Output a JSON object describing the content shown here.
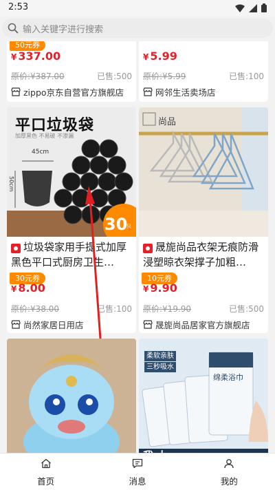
{
  "status_bar": {
    "time": "2:53"
  },
  "search": {
    "placeholder": "输入关键字进行搜索"
  },
  "products": [
    {
      "coupon": "50元券",
      "price": "337.00",
      "original": "原价:¥387.00",
      "sold": "已售:500",
      "shop": "zippo京东自营官方旗舰店"
    },
    {
      "price": "5.99",
      "original": "原价:¥5.99",
      "sold": "已售:100",
      "shop": "网邻生活卖场店"
    },
    {
      "image_text": "平口垃圾袋",
      "image_subtext": "加厚黑色  不易破  不渗漏",
      "image_size_w": "45cm",
      "image_size_h": "50cm",
      "image_badge": "30",
      "image_badge_unit": "只",
      "title": "垃圾袋家用手提式加厚黑色平口式厨房卫生…",
      "coupon": "30元券",
      "price": "8.00",
      "original": "原价:¥38.00",
      "sold": "已售:100",
      "shop": "尚然家居日用店"
    },
    {
      "image_brand": "尚品",
      "title": "晟旎尚品衣架无痕防滑浸塑晾衣架撑子加粗…",
      "coupon": "10元券",
      "price": "9.90",
      "original": "原价:¥19.90",
      "sold": "已售:500",
      "shop": "晟旎尚品居家官方旗舰店"
    },
    {},
    {
      "image_text_line1": "柔软亲肤",
      "image_text_line2": "三秒吸水",
      "image_pack_label": "绵柔浴巾",
      "image_bottom_text": "我 太"
    }
  ],
  "tabbar": [
    {
      "label": "首页",
      "icon": "home-icon"
    },
    {
      "label": "消息",
      "icon": "message-icon"
    },
    {
      "label": "我的",
      "icon": "user-icon"
    }
  ],
  "colors": {
    "price": "#e4202b",
    "coupon": "#ff8a00"
  }
}
